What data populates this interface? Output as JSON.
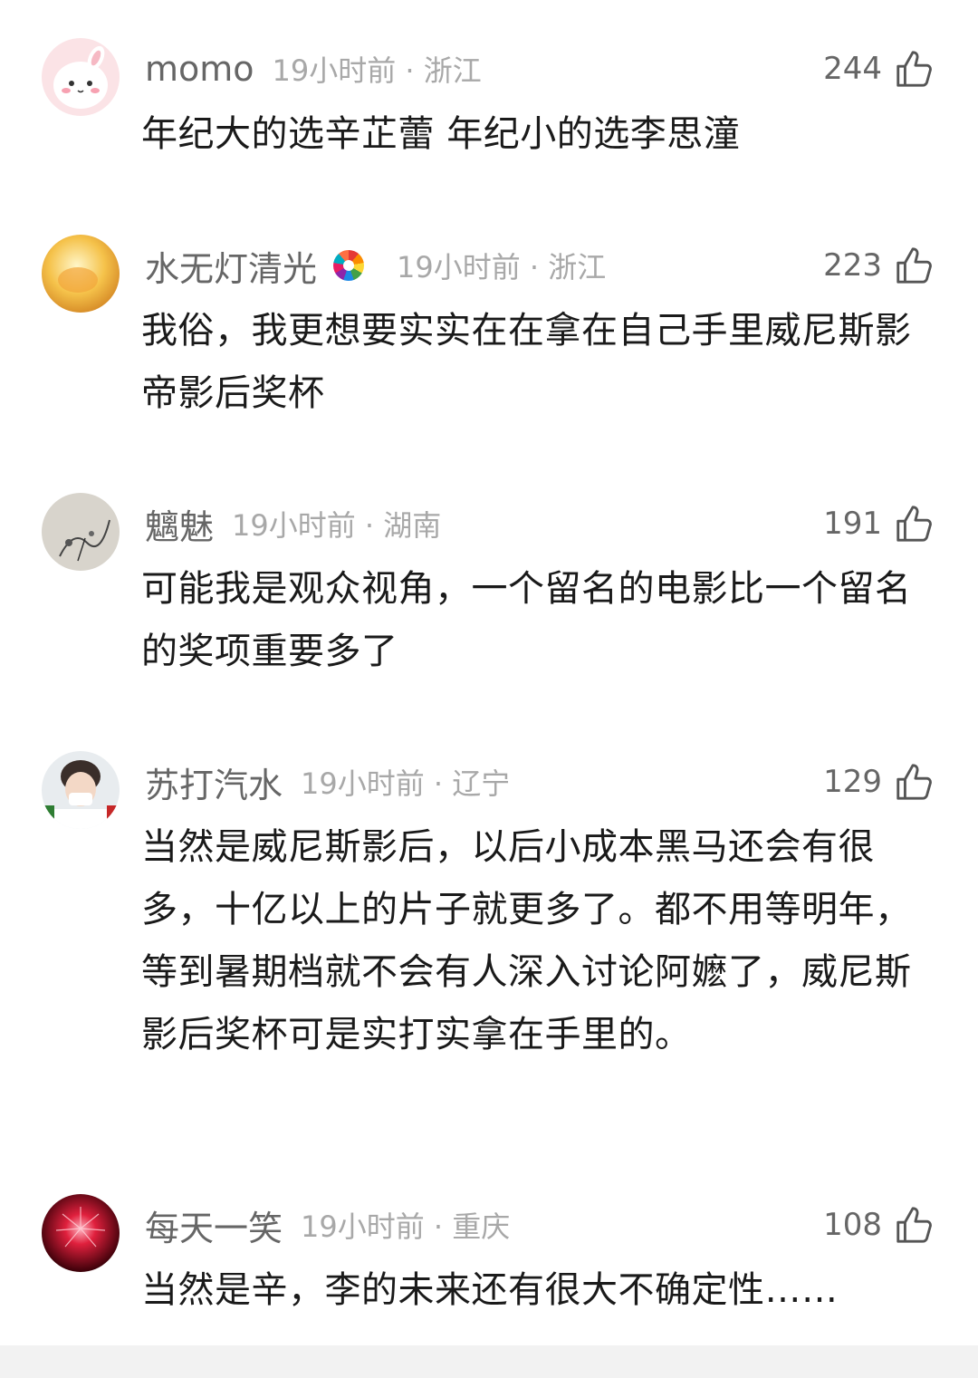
{
  "comments": [
    {
      "username": "momo",
      "time_location": "19小时前 · 浙江",
      "likes": "244",
      "text": "年纪大的选辛芷蕾 年纪小的选李思潼",
      "avatar": "pink-bunny-avatar"
    },
    {
      "username": "水无灯清光",
      "time_location": "19小时前 · 浙江",
      "likes": "223",
      "text": "我俗，我更想要实实在在拿在自己手里威尼斯影帝影后奖杯",
      "avatar": "golden-avatar",
      "badge": "rainbow-badge-icon"
    },
    {
      "username": "魑魅",
      "time_location": "19小时前 · 湖南",
      "likes": "191",
      "text": "可能我是观众视角，一个留名的电影比一个留名的奖项重要多了",
      "avatar": "ink-painting-avatar"
    },
    {
      "username": "苏打汽水",
      "time_location": "19小时前 · 辽宁",
      "likes": "129",
      "text": "当然是威尼斯影后，以后小成本黑马还会有很多，十亿以上的片子就更多了。都不用等明年，等到暑期档就不会有人深入讨论阿嬷了，威尼斯影后奖杯可是实打实拿在手里的。",
      "avatar": "person-photo-avatar"
    },
    {
      "username": "每天一笑",
      "time_location": "19小时前 · 重庆",
      "likes": "108",
      "text": "当然是辛，李的未来还有很大不确定性……",
      "avatar": "red-firework-avatar"
    }
  ],
  "colors": {
    "username": "#666666",
    "meta": "#a8a8a8",
    "text": "#1a1a1a",
    "background": "#ffffff"
  }
}
